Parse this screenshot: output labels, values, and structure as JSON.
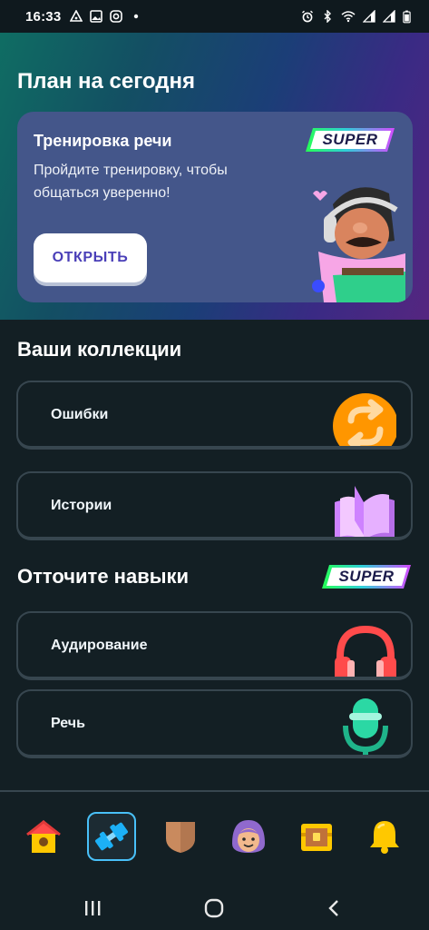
{
  "status_bar": {
    "time": "16:33",
    "left_icons": [
      "cast-icon",
      "image-icon",
      "instagram-icon",
      "dot-icon"
    ],
    "right_icons": [
      "alarm-icon",
      "bluetooth-icon",
      "wifi-icon",
      "signal-icon",
      "signal-icon",
      "battery-icon"
    ]
  },
  "hero": {
    "title": "План на сегодня",
    "card": {
      "title": "Тренировка речи",
      "description": "Пройдите тренировку, чтобы общаться уверенно!",
      "button_label": "ОТКРЫТЬ",
      "badge": "SUPER"
    }
  },
  "collections": {
    "title": "Ваши коллекции",
    "items": [
      {
        "label": "Ошибки",
        "icon": "refresh-icon"
      },
      {
        "label": "Истории",
        "icon": "book-icon"
      }
    ]
  },
  "skills": {
    "title": "Отточите навыки",
    "badge": "SUPER",
    "items": [
      {
        "label": "Аудирование",
        "icon": "headphones-icon"
      },
      {
        "label": "Речь",
        "icon": "microphone-icon"
      }
    ]
  },
  "bottom_nav": [
    "home-icon",
    "practice-icon",
    "league-shield-icon",
    "profile-icon",
    "shop-chest-icon",
    "notifications-bell-icon"
  ],
  "colors": {
    "background": "#131f24",
    "card_border": "#37464f",
    "accent_blue": "#49c0f8",
    "button_text": "#4a3fb8"
  }
}
